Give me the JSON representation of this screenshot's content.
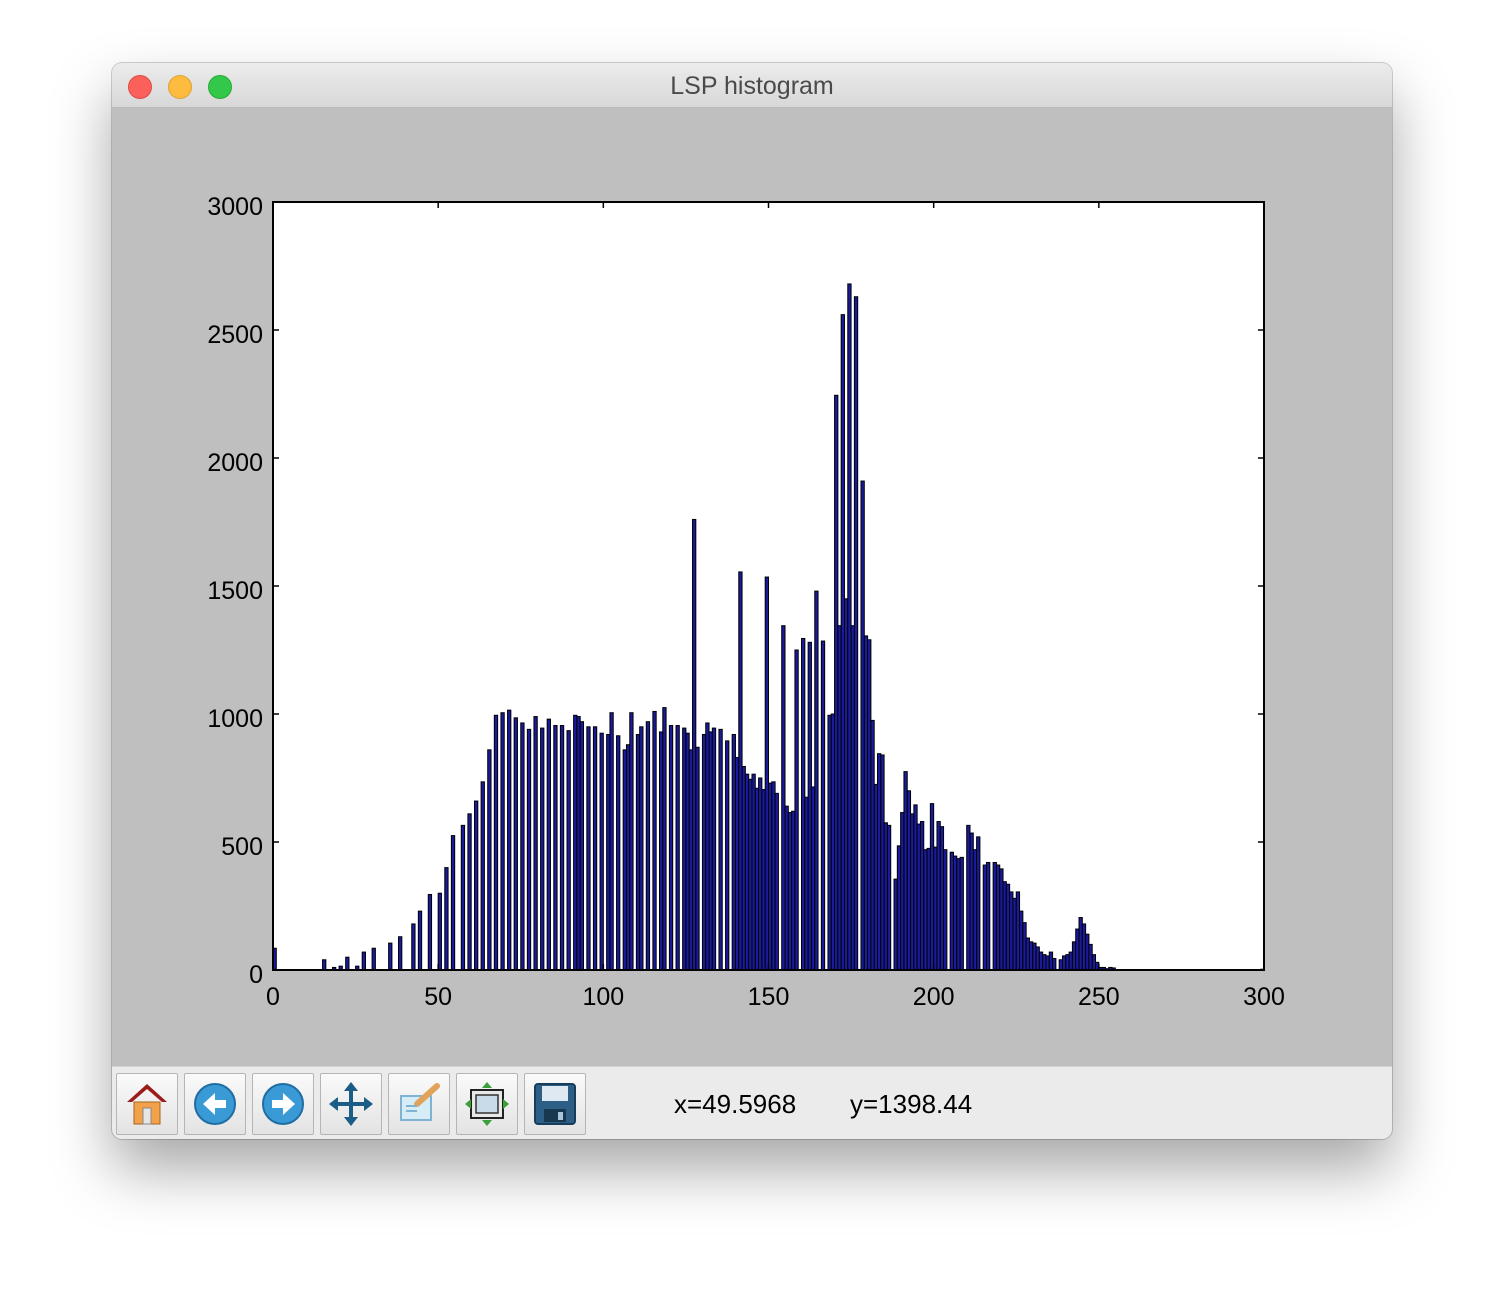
{
  "window": {
    "title": "LSP histogram"
  },
  "toolbar": {
    "buttons": [
      {
        "name": "home",
        "icon": "home-icon"
      },
      {
        "name": "back",
        "icon": "back-arrow-icon"
      },
      {
        "name": "forward",
        "icon": "forward-arrow-icon"
      },
      {
        "name": "pan",
        "icon": "move-arrows-icon"
      },
      {
        "name": "zoom",
        "icon": "zoom-rectangle-icon"
      },
      {
        "name": "configure-subplots",
        "icon": "subplots-icon"
      },
      {
        "name": "save",
        "icon": "floppy-disk-icon"
      }
    ],
    "x_readout": "x=49.5968",
    "y_readout": "y=1398.44"
  },
  "colors": {
    "bar_fill": "#1a1a9c",
    "bar_edge": "#000000",
    "figure_bg": "#bfbfbf",
    "axes_bg": "#ffffff"
  },
  "chart_data": {
    "type": "bar",
    "title": "",
    "xlabel": "",
    "ylabel": "",
    "xlim": [
      0,
      300
    ],
    "ylim": [
      0,
      3000
    ],
    "xticks": [
      0,
      50,
      100,
      150,
      200,
      250,
      300
    ],
    "yticks": [
      0,
      500,
      1000,
      1500,
      2000,
      2500,
      3000
    ],
    "xtick_labels": [
      "0",
      "50",
      "100",
      "150",
      "200",
      "250",
      "300"
    ],
    "ytick_labels": [
      "0",
      "500",
      "1000",
      "1500",
      "2000",
      "2500",
      "3000"
    ],
    "grid": false,
    "bin_width": 1,
    "bins": [
      [
        0,
        85
      ],
      [
        15,
        40
      ],
      [
        18,
        10
      ],
      [
        20,
        15
      ],
      [
        22,
        50
      ],
      [
        25,
        15
      ],
      [
        27,
        70
      ],
      [
        30,
        85
      ],
      [
        35,
        105
      ],
      [
        38,
        130
      ],
      [
        42,
        180
      ],
      [
        44,
        230
      ],
      [
        47,
        295
      ],
      [
        50,
        300
      ],
      [
        52,
        400
      ],
      [
        54,
        525
      ],
      [
        57,
        565
      ],
      [
        59,
        610
      ],
      [
        61,
        660
      ],
      [
        63,
        735
      ],
      [
        65,
        860
      ],
      [
        67,
        995
      ],
      [
        69,
        1005
      ],
      [
        71,
        1015
      ],
      [
        73,
        985
      ],
      [
        75,
        965
      ],
      [
        77,
        940
      ],
      [
        79,
        990
      ],
      [
        81,
        945
      ],
      [
        83,
        980
      ],
      [
        85,
        955
      ],
      [
        87,
        955
      ],
      [
        89,
        935
      ],
      [
        91,
        995
      ],
      [
        92,
        990
      ],
      [
        93,
        970
      ],
      [
        95,
        950
      ],
      [
        97,
        950
      ],
      [
        99,
        925
      ],
      [
        101,
        920
      ],
      [
        102,
        1005
      ],
      [
        104,
        915
      ],
      [
        106,
        860
      ],
      [
        107,
        880
      ],
      [
        108,
        1005
      ],
      [
        110,
        920
      ],
      [
        111,
        950
      ],
      [
        113,
        970
      ],
      [
        115,
        1010
      ],
      [
        117,
        930
      ],
      [
        118,
        1025
      ],
      [
        120,
        955
      ],
      [
        122,
        955
      ],
      [
        124,
        945
      ],
      [
        125,
        925
      ],
      [
        126,
        860
      ],
      [
        127,
        1760
      ],
      [
        128,
        870
      ],
      [
        130,
        920
      ],
      [
        131,
        965
      ],
      [
        132,
        930
      ],
      [
        133,
        945
      ],
      [
        135,
        940
      ],
      [
        137,
        895
      ],
      [
        139,
        920
      ],
      [
        140,
        830
      ],
      [
        141,
        1555
      ],
      [
        142,
        795
      ],
      [
        143,
        765
      ],
      [
        144,
        745
      ],
      [
        145,
        765
      ],
      [
        146,
        710
      ],
      [
        147,
        750
      ],
      [
        148,
        705
      ],
      [
        149,
        1535
      ],
      [
        150,
        730
      ],
      [
        151,
        735
      ],
      [
        152,
        690
      ],
      [
        154,
        1345
      ],
      [
        155,
        640
      ],
      [
        156,
        615
      ],
      [
        157,
        620
      ],
      [
        158,
        1250
      ],
      [
        160,
        1295
      ],
      [
        161,
        675
      ],
      [
        162,
        1280
      ],
      [
        163,
        715
      ],
      [
        164,
        1480
      ],
      [
        166,
        1285
      ],
      [
        168,
        995
      ],
      [
        169,
        1000
      ],
      [
        170,
        2245
      ],
      [
        171,
        1345
      ],
      [
        172,
        2560
      ],
      [
        173,
        1450
      ],
      [
        174,
        2680
      ],
      [
        175,
        1345
      ],
      [
        176,
        2630
      ],
      [
        178,
        1910
      ],
      [
        179,
        1305
      ],
      [
        180,
        1290
      ],
      [
        181,
        975
      ],
      [
        182,
        725
      ],
      [
        183,
        845
      ],
      [
        184,
        840
      ],
      [
        185,
        575
      ],
      [
        186,
        565
      ],
      [
        188,
        355
      ],
      [
        189,
        485
      ],
      [
        190,
        615
      ],
      [
        191,
        775
      ],
      [
        192,
        700
      ],
      [
        193,
        610
      ],
      [
        194,
        645
      ],
      [
        195,
        570
      ],
      [
        196,
        580
      ],
      [
        197,
        470
      ],
      [
        198,
        475
      ],
      [
        199,
        650
      ],
      [
        200,
        480
      ],
      [
        201,
        580
      ],
      [
        202,
        560
      ],
      [
        203,
        470
      ],
      [
        205,
        460
      ],
      [
        206,
        445
      ],
      [
        207,
        435
      ],
      [
        208,
        440
      ],
      [
        210,
        565
      ],
      [
        211,
        535
      ],
      [
        212,
        470
      ],
      [
        213,
        520
      ],
      [
        215,
        410
      ],
      [
        216,
        420
      ],
      [
        218,
        420
      ],
      [
        219,
        410
      ],
      [
        220,
        395
      ],
      [
        221,
        345
      ],
      [
        222,
        335
      ],
      [
        223,
        305
      ],
      [
        224,
        280
      ],
      [
        225,
        305
      ],
      [
        226,
        230
      ],
      [
        227,
        185
      ],
      [
        228,
        125
      ],
      [
        229,
        110
      ],
      [
        230,
        105
      ],
      [
        231,
        90
      ],
      [
        232,
        70
      ],
      [
        233,
        60
      ],
      [
        234,
        55
      ],
      [
        235,
        70
      ],
      [
        236,
        45
      ],
      [
        238,
        40
      ],
      [
        239,
        55
      ],
      [
        240,
        60
      ],
      [
        241,
        70
      ],
      [
        242,
        110
      ],
      [
        243,
        160
      ],
      [
        244,
        205
      ],
      [
        245,
        180
      ],
      [
        246,
        140
      ],
      [
        247,
        100
      ],
      [
        248,
        60
      ],
      [
        249,
        30
      ],
      [
        250,
        10
      ],
      [
        251,
        10
      ],
      [
        252,
        5
      ],
      [
        253,
        10
      ],
      [
        254,
        8
      ],
      [
        299,
        3
      ]
    ]
  }
}
